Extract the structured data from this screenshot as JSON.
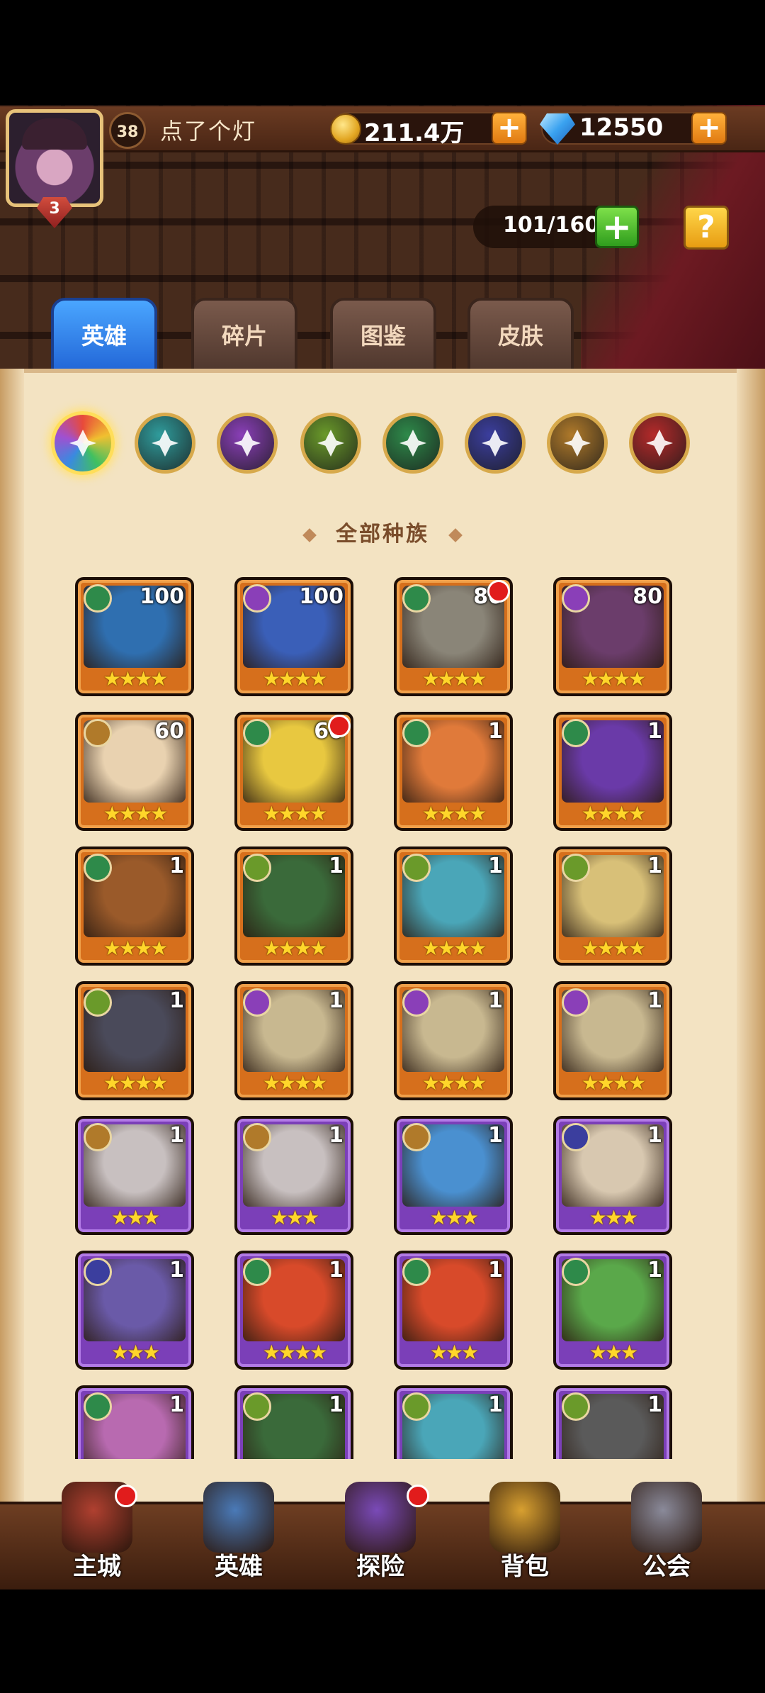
{
  "player": {
    "level": "38",
    "name": "点了个灯",
    "vip": "3"
  },
  "resources": {
    "gold": "211.4万",
    "gems": "12550"
  },
  "capacity": "101/160",
  "help_label": "?",
  "tabs": [
    {
      "label": "英雄",
      "active": true
    },
    {
      "label": "碎片",
      "active": false
    },
    {
      "label": "图鉴",
      "active": false
    },
    {
      "label": "皮肤",
      "active": false
    }
  ],
  "factions": [
    {
      "name": "all-factions",
      "color": "#e05a3a",
      "selected": true
    },
    {
      "name": "faction-water",
      "color": "#2f9c9c"
    },
    {
      "name": "faction-arcane",
      "color": "#8a3fb8"
    },
    {
      "name": "faction-nature-eye",
      "color": "#6a9a2a"
    },
    {
      "name": "faction-forest",
      "color": "#2e8a4a"
    },
    {
      "name": "faction-shadow",
      "color": "#3b3e9e"
    },
    {
      "name": "faction-light",
      "color": "#b07a2a"
    },
    {
      "name": "faction-fire",
      "color": "#b52a2a"
    }
  ],
  "section_title": "全部种族",
  "heroes": [
    {
      "level": "100",
      "stars": "★★★★",
      "frame": "orange",
      "art": "#2f6fb0",
      "race": "#2e8a4a",
      "dot": false
    },
    {
      "level": "100",
      "stars": "★★★★",
      "frame": "orange",
      "art": "#3a5fb8",
      "race": "#8a3fb8",
      "dot": false
    },
    {
      "level": "80",
      "stars": "★★★★",
      "frame": "orange",
      "art": "#8a8578",
      "race": "#2e8a4a",
      "dot": true
    },
    {
      "level": "80",
      "stars": "★★★★",
      "frame": "orange",
      "art": "#6b3d6b",
      "race": "#8a3fb8",
      "dot": false
    },
    {
      "level": "60",
      "stars": "★★★★",
      "frame": "orange",
      "art": "#e9d2b0",
      "race": "#b07a2a",
      "dot": false
    },
    {
      "level": "60",
      "stars": "★★★★",
      "frame": "orange",
      "art": "#e8c840",
      "race": "#2e8a4a",
      "dot": true
    },
    {
      "level": "1",
      "stars": "★★★★",
      "frame": "orange",
      "art": "#e07a3a",
      "race": "#2e8a4a",
      "dot": false
    },
    {
      "level": "1",
      "stars": "★★★★",
      "frame": "orange",
      "art": "#6a3aa8",
      "race": "#2e8a4a",
      "dot": false
    },
    {
      "level": "1",
      "stars": "★★★★",
      "frame": "orange",
      "art": "#9a5a2a",
      "race": "#2e8a4a",
      "dot": false
    },
    {
      "level": "1",
      "stars": "★★★★",
      "frame": "orange",
      "art": "#3a6a3a",
      "race": "#6a9a2a",
      "dot": false
    },
    {
      "level": "1",
      "stars": "★★★★",
      "frame": "orange",
      "art": "#4aa6b8",
      "race": "#6a9a2a",
      "dot": false
    },
    {
      "level": "1",
      "stars": "★★★★",
      "frame": "orange",
      "art": "#d8c078",
      "race": "#6a9a2a",
      "dot": false
    },
    {
      "level": "1",
      "stars": "★★★★",
      "frame": "orange",
      "art": "#4a4a5a",
      "race": "#6a9a2a",
      "dot": false
    },
    {
      "level": "1",
      "stars": "★★★★",
      "frame": "orange",
      "art": "#c8b890",
      "race": "#8a3fb8",
      "dot": false
    },
    {
      "level": "1",
      "stars": "★★★★",
      "frame": "orange",
      "art": "#c8b890",
      "race": "#8a3fb8",
      "dot": false
    },
    {
      "level": "1",
      "stars": "★★★★",
      "frame": "orange",
      "art": "#c8b890",
      "race": "#8a3fb8",
      "dot": false
    },
    {
      "level": "1",
      "stars": "★★★",
      "frame": "purple",
      "art": "#c8c0c0",
      "race": "#b07a2a",
      "dot": false
    },
    {
      "level": "1",
      "stars": "★★★",
      "frame": "purple",
      "art": "#c8c0c0",
      "race": "#b07a2a",
      "dot": false
    },
    {
      "level": "1",
      "stars": "★★★",
      "frame": "purple",
      "art": "#4a90d0",
      "race": "#b07a2a",
      "dot": false
    },
    {
      "level": "1",
      "stars": "★★★",
      "frame": "purple",
      "art": "#d8c8b0",
      "race": "#3b3e9e",
      "dot": false
    },
    {
      "level": "1",
      "stars": "★★★",
      "frame": "purple",
      "art": "#6a5aa8",
      "race": "#3b3e9e",
      "dot": false
    },
    {
      "level": "1",
      "stars": "★★★★",
      "frame": "purple",
      "art": "#d84a2a",
      "race": "#2e8a4a",
      "dot": false
    },
    {
      "level": "1",
      "stars": "★★★",
      "frame": "purple",
      "art": "#d84a2a",
      "race": "#2e8a4a",
      "dot": false
    },
    {
      "level": "1",
      "stars": "★★★",
      "frame": "purple",
      "art": "#5aa84a",
      "race": "#2e8a4a",
      "dot": false
    },
    {
      "level": "1",
      "stars": "",
      "frame": "purple",
      "art": "#b86ab0",
      "race": "#2e8a4a",
      "dot": false
    },
    {
      "level": "1",
      "stars": "",
      "frame": "purple",
      "art": "#3a6a3a",
      "race": "#6a9a2a",
      "dot": false
    },
    {
      "level": "1",
      "stars": "",
      "frame": "purple",
      "art": "#4aa6b8",
      "race": "#6a9a2a",
      "dot": false
    },
    {
      "level": "1",
      "stars": "",
      "frame": "purple",
      "art": "#5a5a5a",
      "race": "#6a9a2a",
      "dot": false
    }
  ],
  "nav": [
    {
      "label": "主城",
      "color": "#b04030",
      "dot": true
    },
    {
      "label": "英雄",
      "color": "#4a7ab8",
      "dot": false
    },
    {
      "label": "探险",
      "color": "#7a4ab8",
      "dot": true
    },
    {
      "label": "背包",
      "color": "#d8a030",
      "dot": false
    },
    {
      "label": "公会",
      "color": "#8a8a9a",
      "dot": false
    }
  ]
}
